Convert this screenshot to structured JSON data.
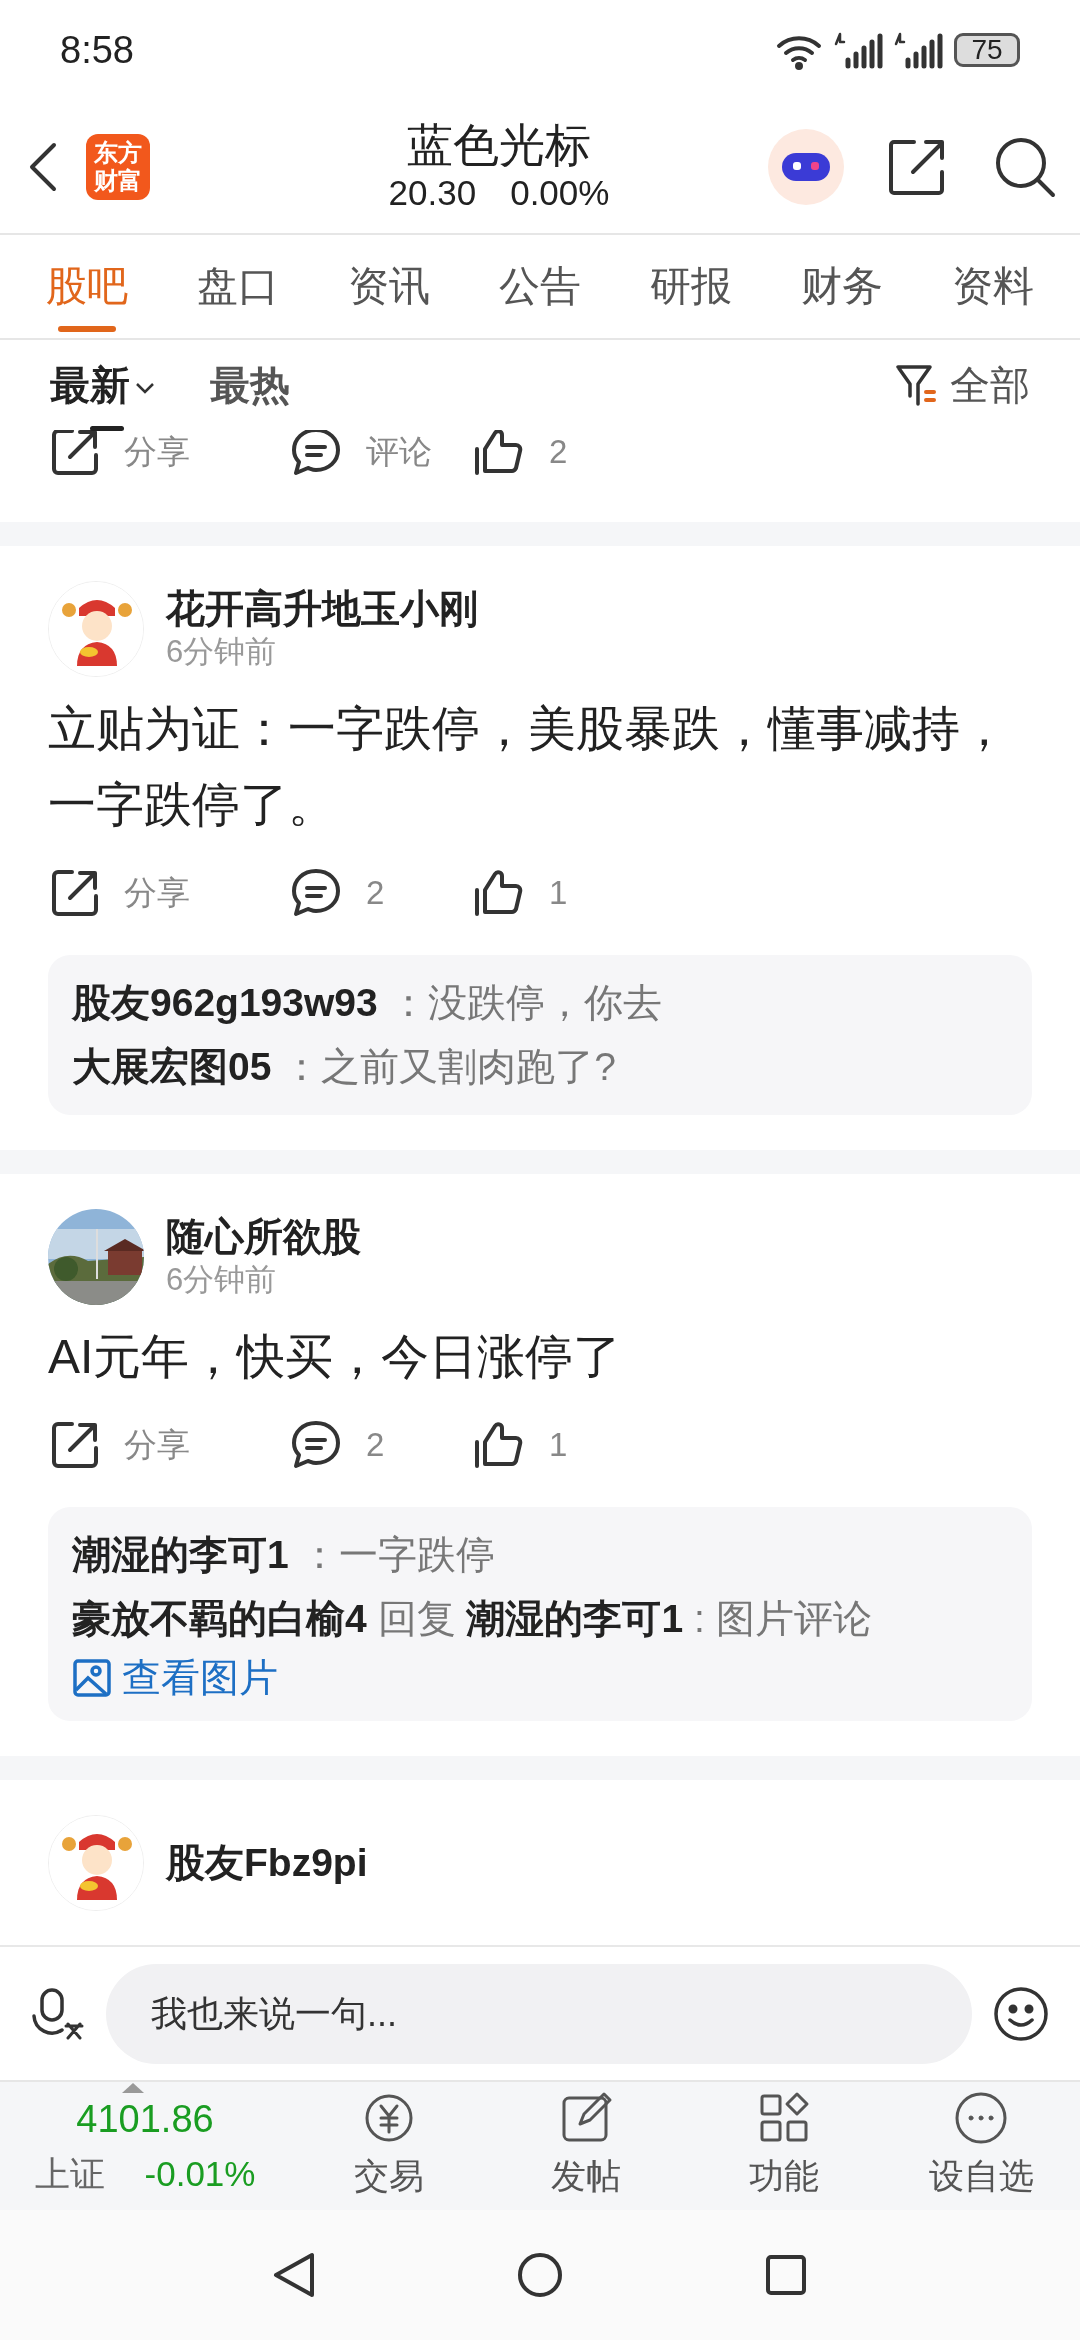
{
  "status_bar": {
    "time": "8:58",
    "battery": "75"
  },
  "header": {
    "logo_lines": [
      "东方",
      "财富"
    ],
    "title": "蓝色光标",
    "price": "20.30",
    "change": "0.00%"
  },
  "tabs": [
    {
      "label": "股吧",
      "selected": true
    },
    {
      "label": "盘口",
      "selected": false
    },
    {
      "label": "资讯",
      "selected": false
    },
    {
      "label": "公告",
      "selected": false
    },
    {
      "label": "研报",
      "selected": false
    },
    {
      "label": "财务",
      "selected": false
    },
    {
      "label": "资料",
      "selected": false
    }
  ],
  "sort_options": [
    {
      "label": "最新",
      "selected": true
    },
    {
      "label": "最热",
      "selected": false
    }
  ],
  "filter": {
    "label": "全部"
  },
  "partial_post": {
    "actions": {
      "share": "分享",
      "comment": "评论",
      "like": "2"
    }
  },
  "posts": [
    {
      "kind": "full",
      "avatar": {
        "kind": "figure"
      },
      "author": "花开高升地玉小刚",
      "time": "6分钟前",
      "body": "立贴为证：一字跌停，美股暴跌，懂事减持，一字跌停了。",
      "actions": {
        "share": "分享",
        "comment": "2",
        "like": "1"
      },
      "comments": [
        {
          "text": "**股友962g193w93** ：没跌停，你去"
        },
        {
          "text": "**大展宏图05** ：之前又割肉跑了?"
        }
      ]
    },
    {
      "kind": "full",
      "avatar": {
        "kind": "picture"
      },
      "author": "随心所欲股",
      "time": "6分钟前",
      "body": "AI元年，快买，今日涨停了",
      "actions": {
        "share": "分享",
        "comment": "2",
        "like": "1"
      },
      "comments": [
        {
          "text": "**潮湿的李可1** ：一字跌停"
        },
        {
          "text": "**豪放不羁的白榆4** 回复 **潮湿的李可1** : 图片评论",
          "link": "查看图片"
        }
      ]
    },
    {
      "kind": "partial",
      "avatar": {
        "kind": "figure"
      },
      "author": "股友Fbz9pi"
    }
  ],
  "comment_bar": {
    "placeholder": "我也来说一句..."
  },
  "index": {
    "value": "4101.86",
    "name": "上证",
    "change": "-0.01%"
  },
  "toolbar": [
    {
      "kind": "trade",
      "label": "交易"
    },
    {
      "kind": "post",
      "label": "发帖"
    },
    {
      "kind": "apps",
      "label": "功能"
    },
    {
      "kind": "more",
      "label": "设自选"
    }
  ]
}
